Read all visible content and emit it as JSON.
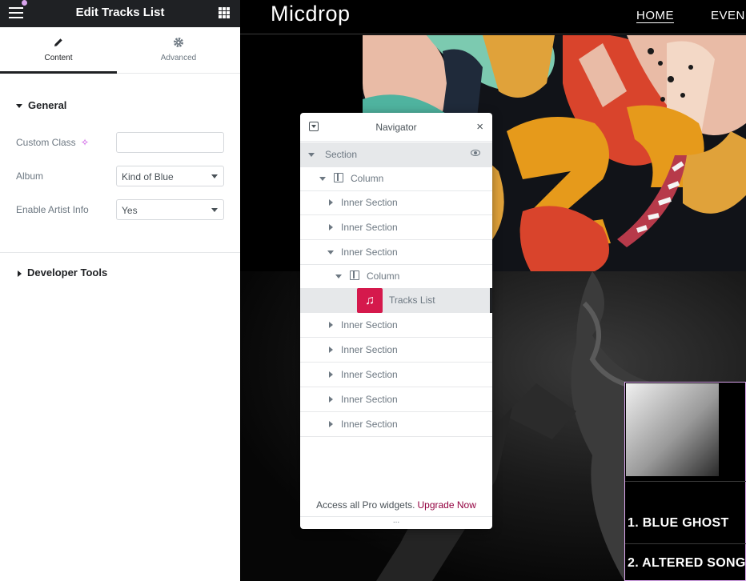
{
  "panel": {
    "title": "Edit Tracks List",
    "tabs": [
      {
        "label": "Content",
        "icon": "pencil-icon"
      },
      {
        "label": "Advanced",
        "icon": "gear-icon"
      }
    ],
    "sections": {
      "general": "General",
      "developer": "Developer Tools"
    },
    "fields": {
      "custom_class": {
        "label": "Custom Class",
        "value": ""
      },
      "album": {
        "label": "Album",
        "value": "Kind of Blue"
      },
      "artist_info": {
        "label": "Enable Artist Info",
        "value": "Yes"
      }
    },
    "collapse": "‹"
  },
  "site": {
    "logo": "Micdrop",
    "menu": [
      "HOME",
      "EVEN"
    ],
    "tracks": [
      "1. BLUE GHOST",
      "2. ALTERED SONG"
    ]
  },
  "navigator": {
    "title": "Navigator",
    "close": "×",
    "items": [
      {
        "label": "Section",
        "depth": 0,
        "type": "section",
        "state": "open"
      },
      {
        "label": "Column",
        "depth": 1,
        "type": "column",
        "state": "open"
      },
      {
        "label": "Inner Section",
        "depth": 2,
        "type": "inner",
        "state": "closed"
      },
      {
        "label": "Inner Section",
        "depth": 2,
        "type": "inner",
        "state": "closed"
      },
      {
        "label": "Inner Section",
        "depth": 2,
        "type": "inner",
        "state": "open"
      },
      {
        "label": "Column",
        "depth": 3,
        "type": "column",
        "state": "open"
      },
      {
        "label": "Tracks List",
        "depth": 4,
        "type": "widget",
        "state": "selected"
      },
      {
        "label": "Inner Section",
        "depth": 2,
        "type": "inner",
        "state": "closed"
      },
      {
        "label": "Inner Section",
        "depth": 2,
        "type": "inner",
        "state": "closed"
      },
      {
        "label": "Inner Section",
        "depth": 2,
        "type": "inner",
        "state": "closed"
      },
      {
        "label": "Inner Section",
        "depth": 2,
        "type": "inner",
        "state": "closed"
      },
      {
        "label": "Inner Section",
        "depth": 2,
        "type": "inner",
        "state": "closed"
      }
    ],
    "footer_text": "Access all Pro widgets.",
    "footer_link": "Upgrade Now",
    "grip": "..."
  },
  "colors": {
    "accent": "#93003f",
    "widget_icon": "#d5194c",
    "panel_header": "#1f2124",
    "card_border": "#d8a4ec"
  }
}
